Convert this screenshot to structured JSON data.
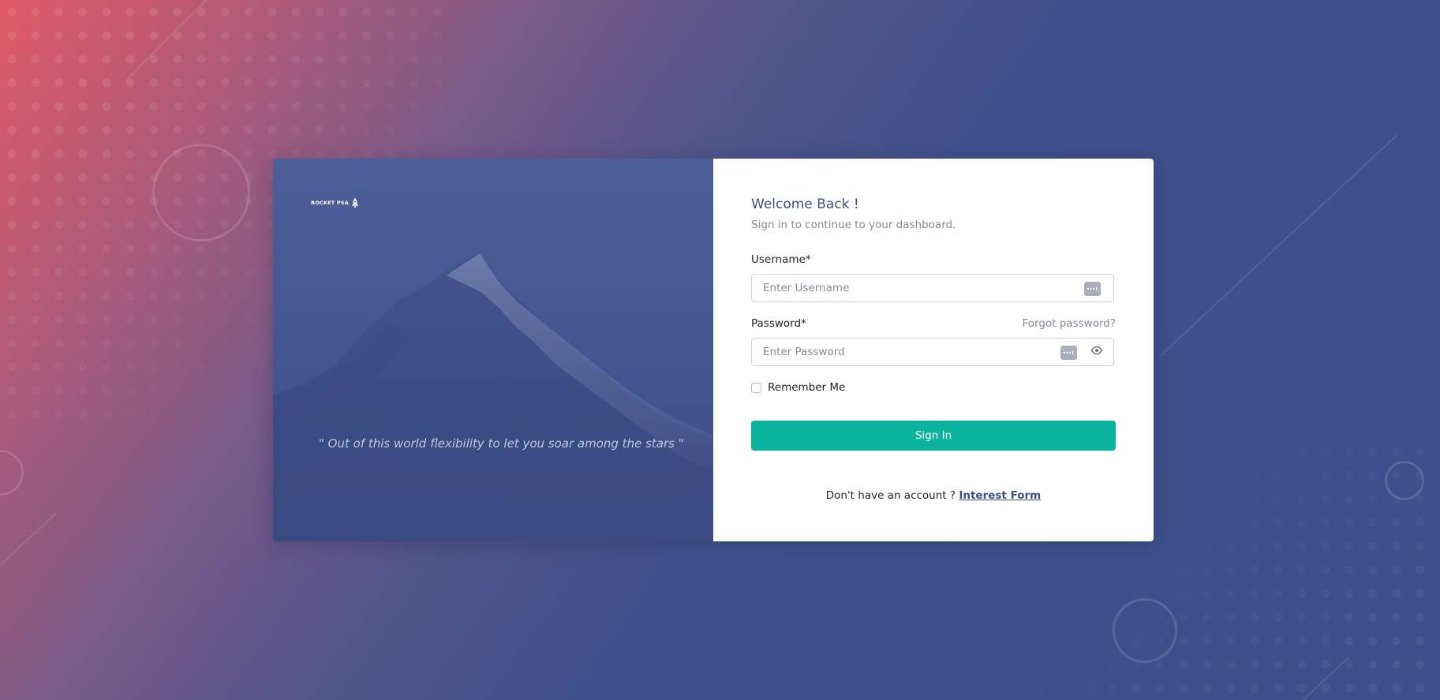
{
  "brand": {
    "logo_text": "ROCKET PSA",
    "logo_icon": "rocket-icon",
    "quote": "\" Out of this world flexibility to let you soar among the stars \""
  },
  "form": {
    "title": "Welcome Back !",
    "subtitle": "Sign in to continue to your dashboard.",
    "username_label": "Username*",
    "username_placeholder": "Enter Username",
    "username_value": "",
    "password_label": "Password*",
    "forgot_link": "Forgot password?",
    "password_placeholder": "Enter Password",
    "password_value": "",
    "remember_label": "Remember Me",
    "remember_checked": false,
    "submit_label": "Sign In",
    "signup_prompt": "Don't have an account ?",
    "signup_link": "Interest Form"
  },
  "icons": {
    "password_manager": "password-manager-icon",
    "show_password": "eye-icon"
  },
  "colors": {
    "primary": "#405189",
    "success": "#0ab39c",
    "muted": "#878a99",
    "bg_gradient_start": "#e05a66",
    "bg_gradient_end": "#3e508b"
  }
}
